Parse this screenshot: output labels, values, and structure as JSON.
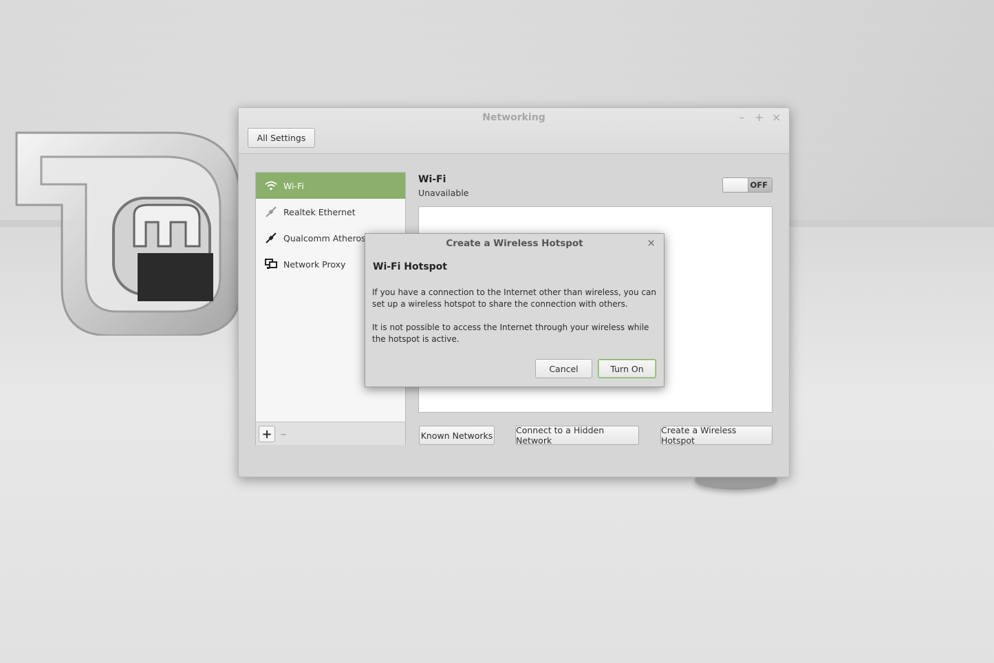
{
  "window": {
    "title": "Networking",
    "controls": {
      "minimize": "–",
      "maximize": "+",
      "close": "×"
    },
    "all_settings_label": "All Settings"
  },
  "sidebar": {
    "items": [
      {
        "label": "Wi-Fi",
        "icon": "wifi-icon",
        "active": true
      },
      {
        "label": "Realtek Ethernet",
        "icon": "ethernet-icon",
        "active": false
      },
      {
        "label": "Qualcomm Atheros E",
        "icon": "ethernet-icon",
        "active": false
      },
      {
        "label": "Network Proxy",
        "icon": "network-proxy-icon",
        "active": false
      }
    ],
    "add_label": "+",
    "remove_label": "–"
  },
  "wifi": {
    "title": "Wi-Fi",
    "status": "Unavailable",
    "toggle_label": "OFF"
  },
  "buttons": {
    "known_networks": "Known Networks",
    "hidden_network": "Connect to a Hidden Network",
    "create_hotspot": "Create a Wireless Hotspot"
  },
  "dialog": {
    "title": "Create a Wireless Hotspot",
    "close": "×",
    "heading": "Wi-Fi Hotspot",
    "text1": "If you have a connection to the Internet other than wireless, you can set up a wireless hotspot to share the connection with others.",
    "text2": "It is not possible to access the Internet through your wireless while the hotspot is active.",
    "cancel_label": "Cancel",
    "turn_on_label": "Turn On"
  },
  "colors": {
    "accent": "#8ab06b",
    "window_bg": "#d6d6d6"
  }
}
